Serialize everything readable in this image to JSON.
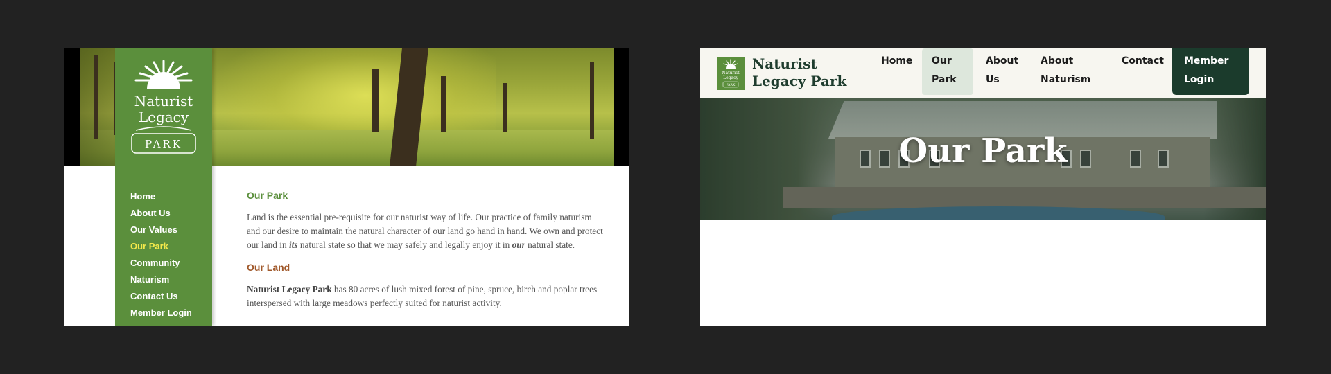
{
  "old_site": {
    "logo": {
      "line1": "Naturist",
      "line2": "Legacy",
      "badge": "PARK"
    },
    "nav": [
      {
        "label": "Home"
      },
      {
        "label": "About Us"
      },
      {
        "label": "Our Values"
      },
      {
        "label": "Our Park",
        "active": true
      },
      {
        "label": "Community"
      },
      {
        "label": "Naturism"
      },
      {
        "label": "Contact Us"
      },
      {
        "label": "Member Login"
      }
    ],
    "heading1": "Our Park",
    "para1_a": "Land is the essential pre-requisite for our naturist way of life. Our practice of family naturism and our desire to maintain the natural character of our land go hand in hand. We own and protect our land in ",
    "para1_em1": "its",
    "para1_b": " natural state so that we may safely and legally enjoy it in ",
    "para1_em2": "our",
    "para1_c": " natural state.",
    "heading2": "Our Land",
    "para2_bold": "Naturist Legacy Park",
    "para2_rest": " has 80 acres of lush mixed forest of pine, spruce, birch and poplar trees interspersed with large meadows perfectly suited for naturist activity.",
    "colors": {
      "sidebar": "#5b8f3c",
      "active_nav": "#f2e84b",
      "heading_green": "#5b8f3c",
      "heading_brown": "#a0582a"
    }
  },
  "new_site": {
    "brand": "Naturist Legacy Park",
    "logo": {
      "line1": "Naturist",
      "line2": "Legacy",
      "badge": "PARK"
    },
    "nav": [
      {
        "label": "Home"
      },
      {
        "label": "Our Park",
        "active": true
      },
      {
        "label": "About Us"
      },
      {
        "label": "About Naturism"
      },
      {
        "label": "Contact"
      }
    ],
    "member_button": "Member Login",
    "hero_title": "Our Park",
    "colors": {
      "header_bg": "#f7f6f0",
      "active_nav_bg": "#dde7dc",
      "member_btn": "#1b3b2c",
      "brand_text": "#1f3d2e"
    }
  }
}
